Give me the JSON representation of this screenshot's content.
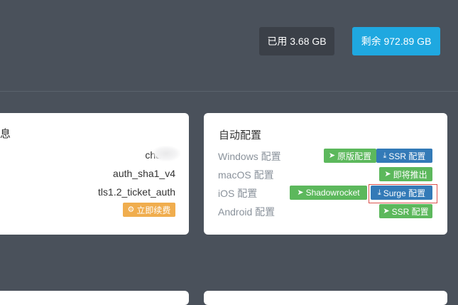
{
  "header": {
    "used_label": "已用 3.68 GB",
    "remaining_label": "剩余 972.89 GB"
  },
  "account_card": {
    "title_fragment": "息",
    "rows": [
      "chac",
      "auth_sha1_v4",
      "tls1.2_ticket_auth"
    ],
    "renew_button": "立即续费",
    "renew_icon": "gear-icon"
  },
  "config_card": {
    "title": "自动配置",
    "platforms": [
      {
        "label": "Windows 配置"
      },
      {
        "label": "macOS 配置"
      },
      {
        "label": "iOS 配置"
      },
      {
        "label": "Android 配置"
      }
    ],
    "buttons": {
      "windows_original": "原版配置",
      "windows_ssr": "SSR 配置",
      "macos_coming": "即将推出",
      "ios_shadowrocket": "Shadowrocket",
      "ios_surge": "Surge 配置",
      "android_ssr": "SSR 配置"
    },
    "icons": {
      "send": "paper-plane-icon",
      "download": "download-icon"
    }
  },
  "colors": {
    "background": "#4a515b",
    "used_badge": "#3b4048",
    "remaining_badge": "#1fa8e0",
    "green": "#5cb85c",
    "blue": "#337ab7",
    "orange": "#f0ad4e",
    "highlight": "#d9534f"
  }
}
